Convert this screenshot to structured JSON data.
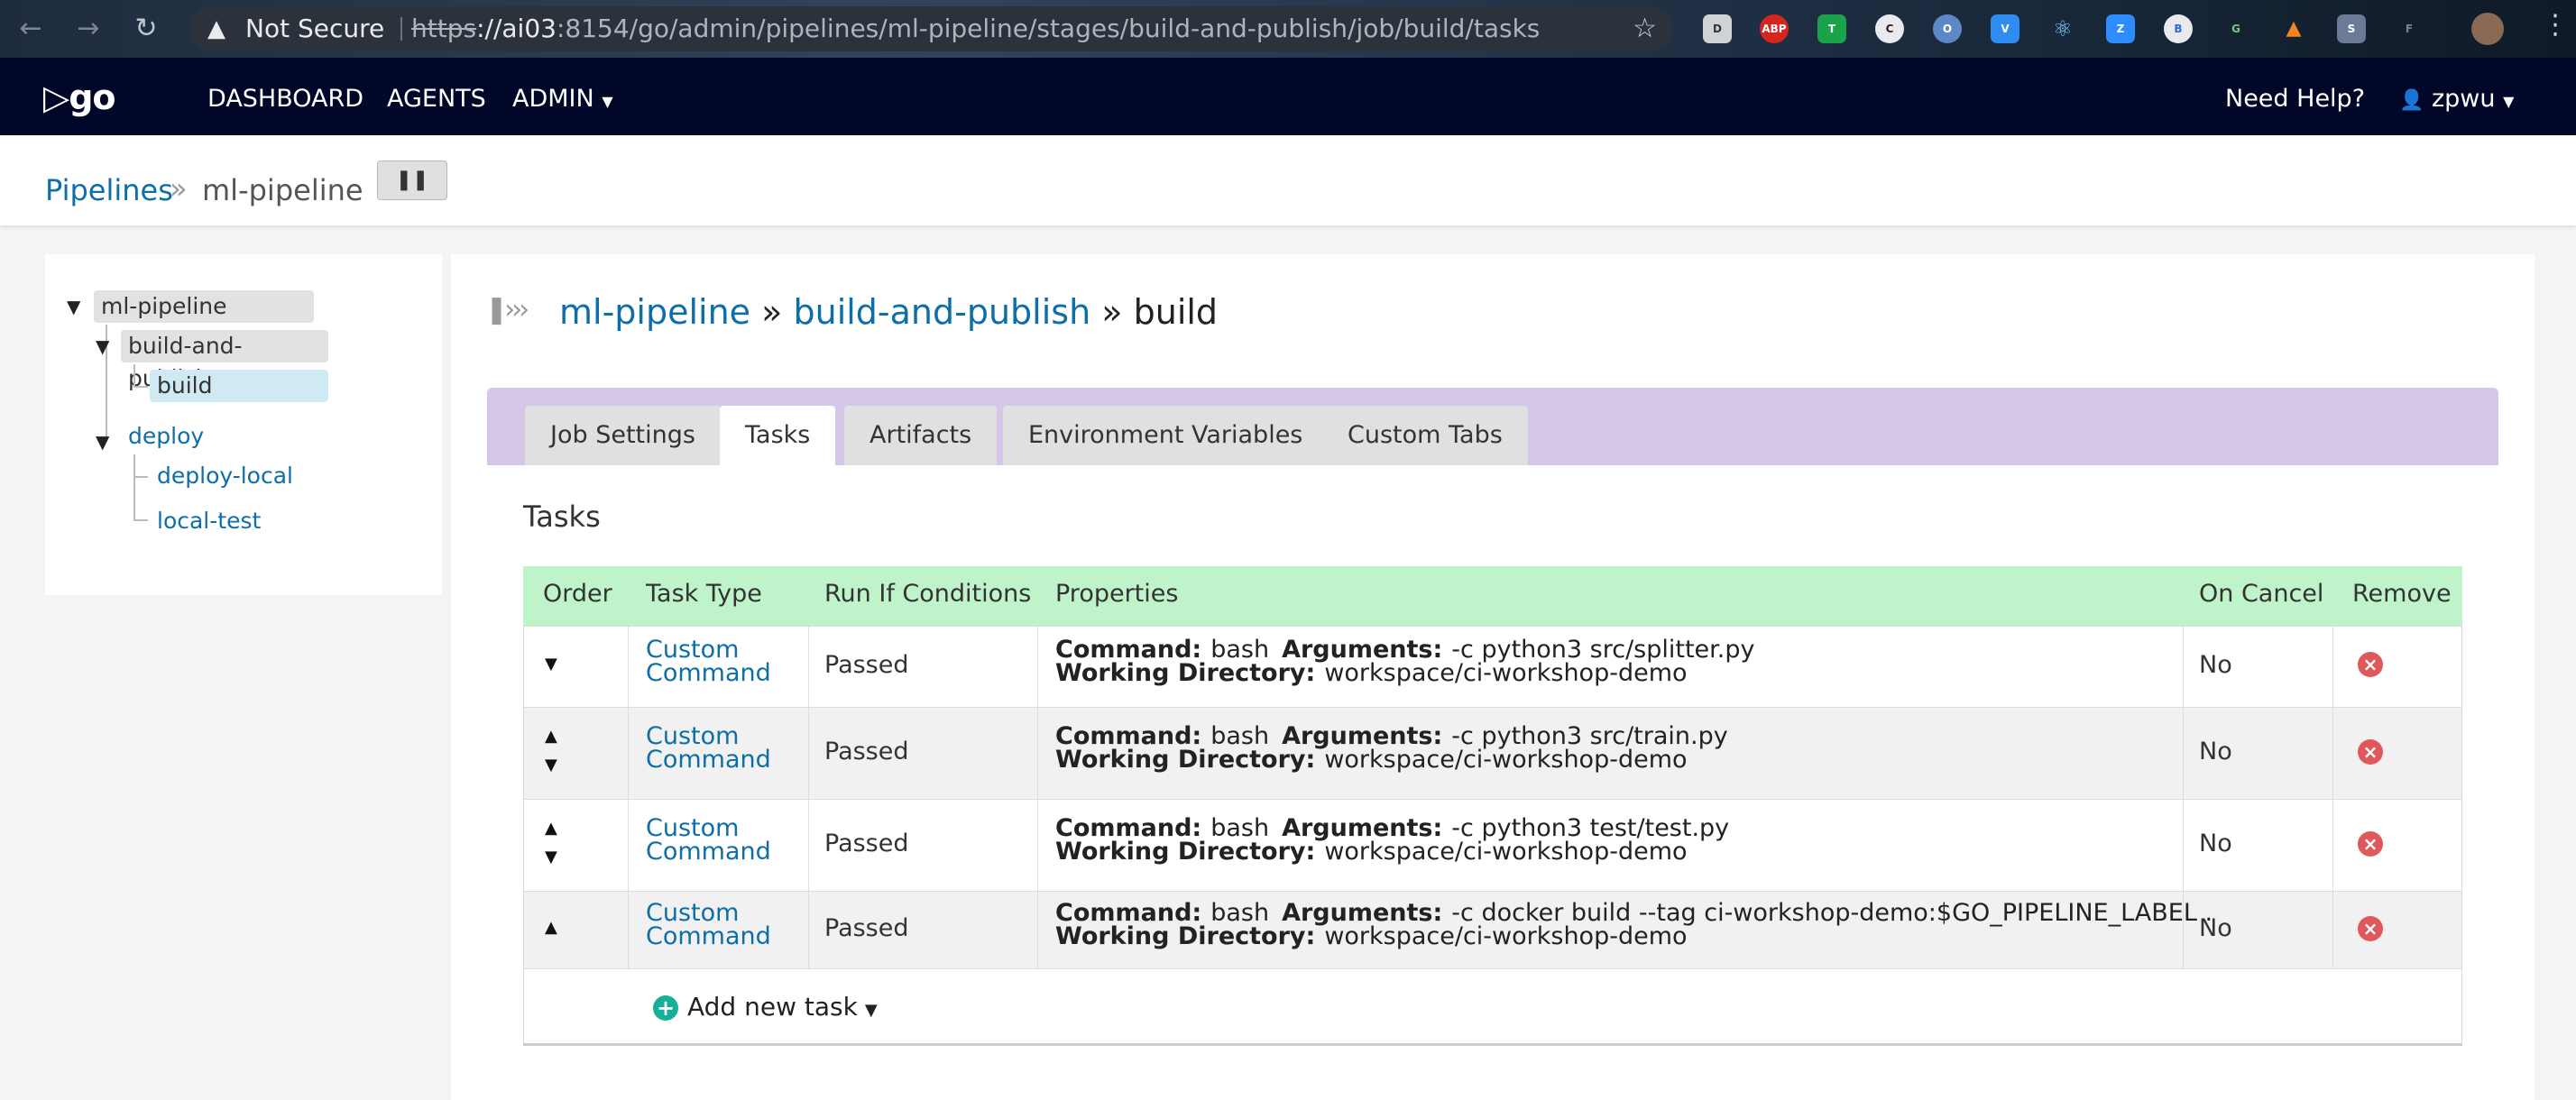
{
  "browser": {
    "security_label": "Not Secure",
    "url_scheme": "https",
    "url_host": "://ai03",
    "url_rest": ":8154/go/admin/pipelines/ml-pipeline/stages/build-and-publish/job/build/tasks",
    "extensions": [
      "ABP",
      "T",
      "C",
      "O",
      "V",
      "R",
      "Z",
      "B",
      "G",
      "F",
      "S",
      "D"
    ]
  },
  "nav": {
    "logo": "go",
    "links": [
      "DASHBOARD",
      "AGENTS",
      "ADMIN"
    ],
    "help": "Need Help?",
    "user": "zpwu"
  },
  "breadcrumb": {
    "root": "Pipelines",
    "current": "ml-pipeline"
  },
  "tree": {
    "pipeline": "ml-pipeline",
    "stages": [
      {
        "name": "build-and-publish",
        "jobs": [
          "build"
        ]
      },
      {
        "name": "deploy",
        "jobs": [
          "deploy-local",
          "local-test"
        ]
      }
    ]
  },
  "title": {
    "pipeline": "ml-pipeline",
    "stage": "build-and-publish",
    "job": "build",
    "separator": "»"
  },
  "tabs": [
    "Job Settings",
    "Tasks",
    "Artifacts",
    "Environment Variables",
    "Custom Tabs"
  ],
  "tasks_heading": "Tasks",
  "table": {
    "headers": [
      "Order",
      "Task Type",
      "Run If Conditions",
      "Properties",
      "On Cancel",
      "Remove"
    ],
    "rows": [
      {
        "type1": "Custom",
        "type2": "Command",
        "run_if": "Passed",
        "command_label": "Command:",
        "command": "bash",
        "args_label": "Arguments:",
        "args": "-c python3 src/splitter.py",
        "wd_label": "Working Directory:",
        "wd": "workspace/ci-workshop-demo",
        "on_cancel": "No"
      },
      {
        "type1": "Custom",
        "type2": "Command",
        "run_if": "Passed",
        "command_label": "Command:",
        "command": "bash",
        "args_label": "Arguments:",
        "args": "-c python3 src/train.py",
        "wd_label": "Working Directory:",
        "wd": "workspace/ci-workshop-demo",
        "on_cancel": "No"
      },
      {
        "type1": "Custom",
        "type2": "Command",
        "run_if": "Passed",
        "command_label": "Command:",
        "command": "bash",
        "args_label": "Arguments:",
        "args": "-c python3 test/test.py",
        "wd_label": "Working Directory:",
        "wd": "workspace/ci-workshop-demo",
        "on_cancel": "No"
      },
      {
        "type1": "Custom",
        "type2": "Command",
        "run_if": "Passed",
        "command_label": "Command:",
        "command": "bash",
        "args_label": "Arguments:",
        "args": "-c docker build --tag ci-workshop-demo:$GO_PIPELINE_LABEL .",
        "wd_label": "Working Directory:",
        "wd": "workspace/ci-workshop-demo",
        "on_cancel": "No"
      }
    ]
  },
  "add_task_label": "Add new task"
}
